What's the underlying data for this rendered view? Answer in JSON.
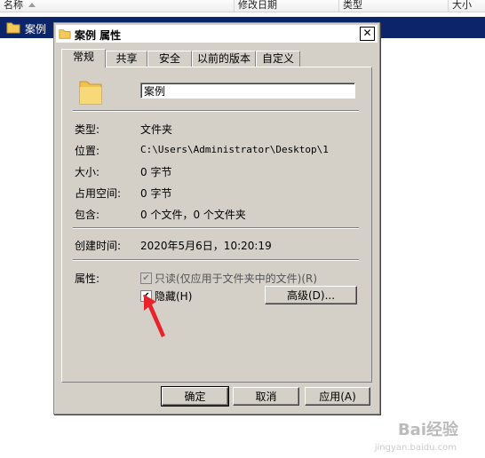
{
  "explorer": {
    "columns": [
      "名称",
      "修改日期",
      "类型",
      "大小"
    ],
    "selected_item": "案例"
  },
  "dialog": {
    "title": "案例 属性",
    "close_label": "✕",
    "tabs": [
      {
        "label": "常规",
        "active": true
      },
      {
        "label": "共享",
        "active": false
      },
      {
        "label": "安全",
        "active": false
      },
      {
        "label": "以前的版本",
        "active": false
      },
      {
        "label": "自定义",
        "active": false
      }
    ],
    "name_value": "案例",
    "fields": {
      "type_label": "类型:",
      "type_value": "文件夹",
      "location_label": "位置:",
      "location_value": "C:\\Users\\Administrator\\Desktop\\1",
      "size_label": "大小:",
      "size_value": "0 字节",
      "size_on_disk_label": "占用空间:",
      "size_on_disk_value": "0 字节",
      "contains_label": "包含:",
      "contains_value": "0 个文件，0 个文件夹",
      "created_label": "创建时间:",
      "created_value": "2020年5月6日，10:20:19",
      "attributes_label": "属性:"
    },
    "attributes": {
      "readonly_label": "只读(仅应用于文件夹中的文件)(R)",
      "readonly_checked": true,
      "hidden_label": "隐藏(H)",
      "hidden_checked": true,
      "advanced_label": "高级(D)..."
    },
    "buttons": {
      "ok": "确定",
      "cancel": "取消",
      "apply": "应用(A)"
    }
  },
  "watermark": {
    "text": "Bai经验",
    "sub": "jingyan.baidu.com"
  },
  "colors": {
    "selection": "#0b246a",
    "dialog_bg": "#d4d0c8",
    "arrow": "#e8242a",
    "folder": "#f3c95a"
  }
}
